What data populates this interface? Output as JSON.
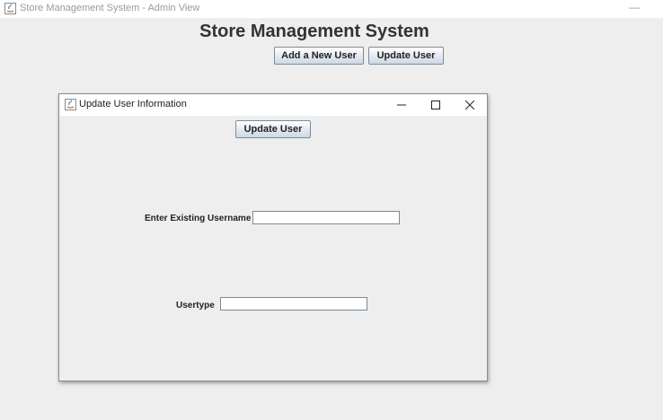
{
  "window": {
    "title": "Store Management System - Admin View",
    "minimize_glyph": "—"
  },
  "header": {
    "title": "Store Management System",
    "add_user_label": "Add a New User",
    "update_user_label": "Update User"
  },
  "dialog": {
    "title": "Update User Information",
    "update_button_label": "Update User",
    "username_label": "Enter Existing Username",
    "username_value": "",
    "usertype_label": "Usertype",
    "usertype_value": ""
  },
  "colors": {
    "background": "#eeeeee",
    "titlebar": "#ffffff",
    "button_border": "#7a8a99"
  }
}
